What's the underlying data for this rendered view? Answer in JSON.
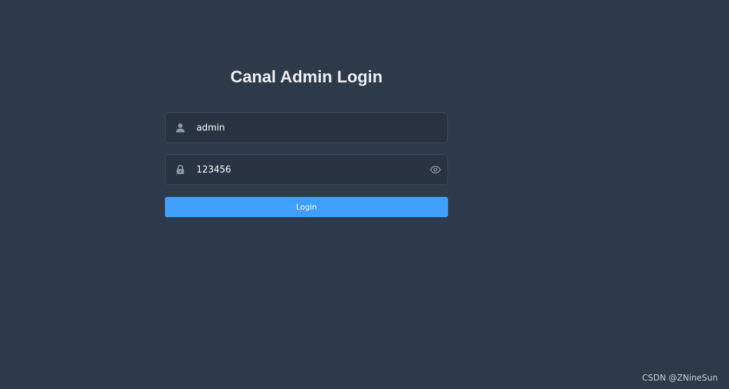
{
  "title": "Canal Admin Login",
  "username": {
    "value": "admin",
    "icon": "user-icon"
  },
  "password": {
    "value": "123456",
    "icon": "lock-icon",
    "toggle_icon": "eye-icon"
  },
  "login_button": {
    "label": "Login"
  },
  "watermark": "CSDN @ZNineSun",
  "colors": {
    "background": "#2d3a4b",
    "input_background": "#283443",
    "primary": "#409eff",
    "icon": "#889aa4"
  }
}
